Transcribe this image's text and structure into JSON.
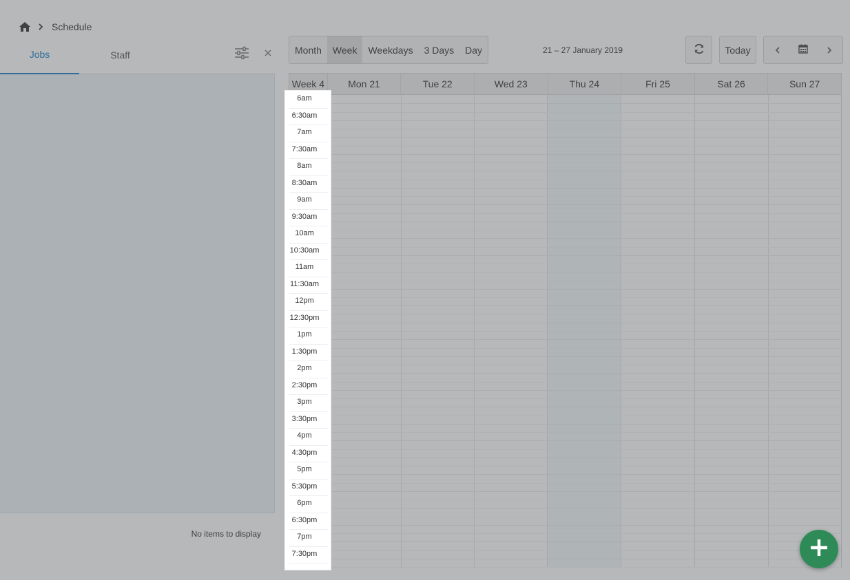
{
  "breadcrumb": {
    "current": "Schedule"
  },
  "left_panel": {
    "tabs": [
      {
        "label": "Jobs",
        "active": true
      },
      {
        "label": "Staff",
        "active": false
      }
    ],
    "empty_text": "No items to display"
  },
  "toolbar": {
    "views": [
      {
        "label": "Month",
        "active": false
      },
      {
        "label": "Week",
        "active": true
      },
      {
        "label": "Weekdays",
        "active": false
      },
      {
        "label": "3 Days",
        "active": false
      },
      {
        "label": "Day",
        "active": false
      }
    ],
    "date_range": "21 – 27 January 2019",
    "today_label": "Today"
  },
  "calendar": {
    "week_label": "Week 4",
    "days": [
      "Mon 21",
      "Tue 22",
      "Wed 23",
      "Thu 24",
      "Fri 25",
      "Sat 26",
      "Sun 27"
    ],
    "highlighted_day": "Thu 24",
    "times": [
      "6am",
      "6:30am",
      "7am",
      "7:30am",
      "8am",
      "8:30am",
      "9am",
      "9:30am",
      "10am",
      "10:30am",
      "11am",
      "11:30am",
      "12pm",
      "12:30pm",
      "1pm",
      "1:30pm",
      "2pm",
      "2:30pm",
      "3pm",
      "3:30pm",
      "4pm",
      "4:30pm",
      "5pm",
      "5:30pm",
      "6pm",
      "6:30pm",
      "7pm",
      "7:30pm"
    ]
  },
  "colors": {
    "accent": "#1a7ec4",
    "fab": "#2e8b57",
    "today_column": "#f3f8f9"
  }
}
